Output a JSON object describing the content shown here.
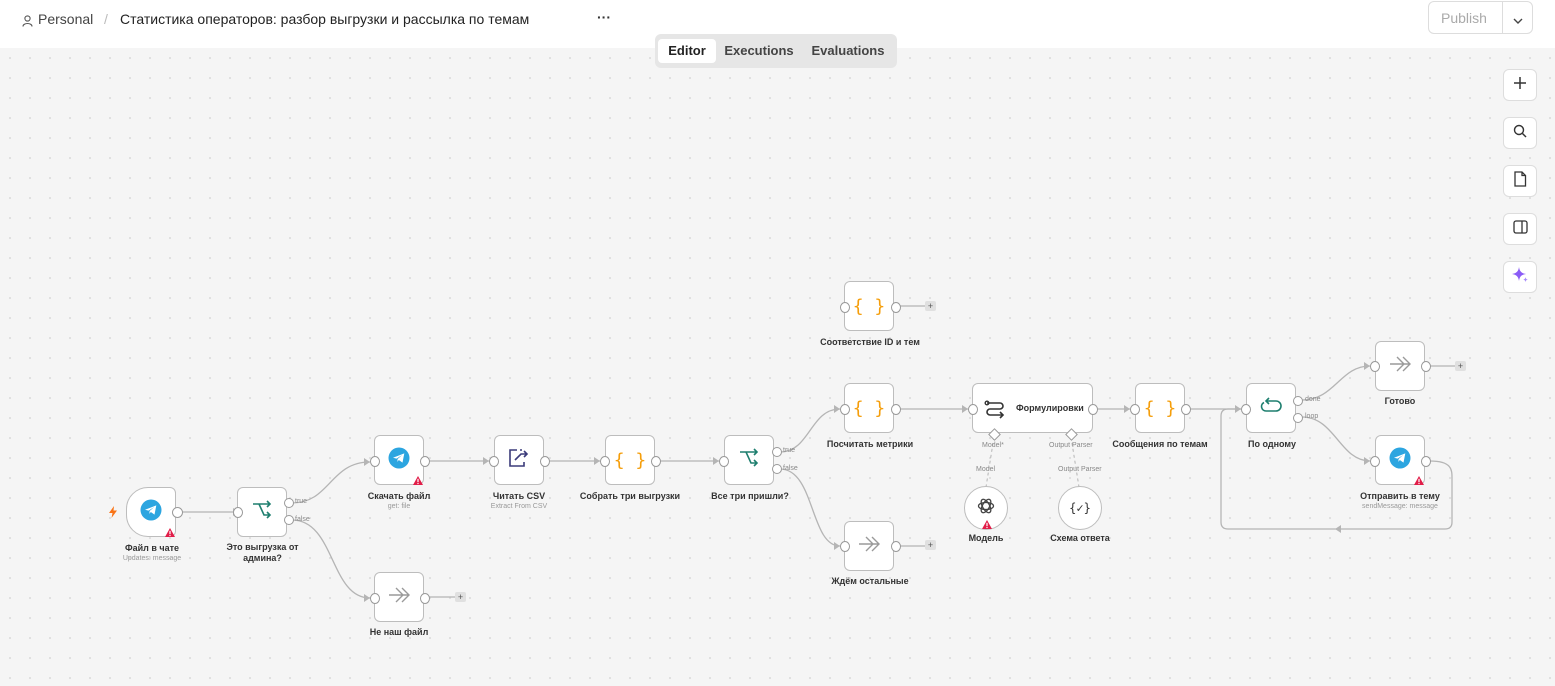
{
  "header": {
    "project": "Personal",
    "separator": "/",
    "workflow_title": "Статистика операторов: разбор выгрузки и рассылка по темам",
    "more": "···",
    "publish_label": "Publish"
  },
  "tabs": [
    {
      "label": "Editor",
      "active": true
    },
    {
      "label": "Executions",
      "active": false
    },
    {
      "label": "Evaluations",
      "active": false
    }
  ],
  "nodes": {
    "file_in_chat": {
      "label": "Файл в чате",
      "sub": "Updates: message"
    },
    "is_admin_upload": {
      "label": "Это выгрузка от админа?",
      "out_true": "true",
      "out_false": "false"
    },
    "download_file": {
      "label": "Скачать файл",
      "sub": "get: file"
    },
    "not_our_file": {
      "label": "Не наш файл"
    },
    "read_csv": {
      "label": "Читать CSV",
      "sub": "Extract From CSV"
    },
    "collect_three": {
      "label": "Собрать три выгрузки"
    },
    "all_three": {
      "label": "Все три пришли?",
      "out_true": "true",
      "out_false": "false"
    },
    "id_topic_map": {
      "label": "Соответствие ID и тем"
    },
    "count_metrics": {
      "label": "Посчитать метрики"
    },
    "wait_others": {
      "label": "Ждём остальные"
    },
    "wording": {
      "label": "Формулировки",
      "port_model": "Model*",
      "port_parser": "Output Parser"
    },
    "model": {
      "label": "Модель",
      "port_label": "Model"
    },
    "response_schema": {
      "label": "Схема ответа",
      "port_label": "Output Parser"
    },
    "topic_messages": {
      "label": "Сообщения по темам"
    },
    "one_by_one": {
      "label": "По одному",
      "out_done": "done",
      "out_loop": "loop"
    },
    "done": {
      "label": "Готово"
    },
    "send_to_topic": {
      "label": "Отправить в тему",
      "sub": "sendMessage: message"
    }
  },
  "plus": "+",
  "colors": {
    "accent_orange": "#f59e0b",
    "telegram_blue": "#2ca5e0",
    "teal": "#1e7f6f",
    "warning_red": "#e11d48",
    "ai_purple": "#8b5cf6"
  },
  "icons": [
    "user-icon",
    "telegram-icon",
    "switch-icon",
    "extract-icon",
    "code-braces-icon",
    "noop-arrows-icon",
    "agent-icon",
    "openai-icon",
    "json-schema-icon",
    "loop-icon",
    "zoom-in-icon",
    "search-icon",
    "sticky-note-icon",
    "panel-icon",
    "sparkle-icon",
    "warning-icon",
    "trigger-bolt-icon",
    "chevron-down-icon"
  ]
}
